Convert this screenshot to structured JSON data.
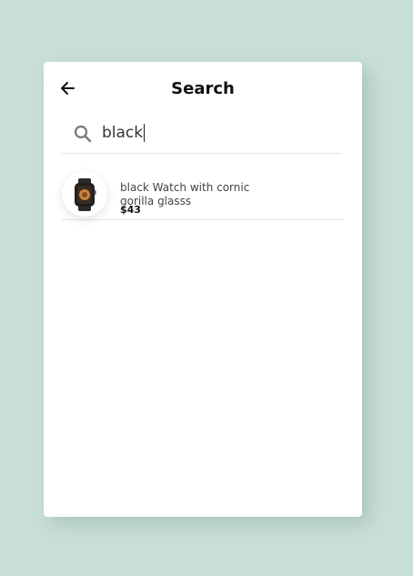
{
  "header": {
    "title": "Search",
    "back_icon": "arrow-left-icon"
  },
  "search": {
    "value": "black",
    "icon": "search-icon"
  },
  "results": [
    {
      "name": "black Watch with cornic gorilla glasss",
      "price": "$43",
      "image": "smartwatch-icon"
    }
  ],
  "colors": {
    "background": "#c8dfd6",
    "card": "#ffffff",
    "divider": "#e6e6e6"
  }
}
